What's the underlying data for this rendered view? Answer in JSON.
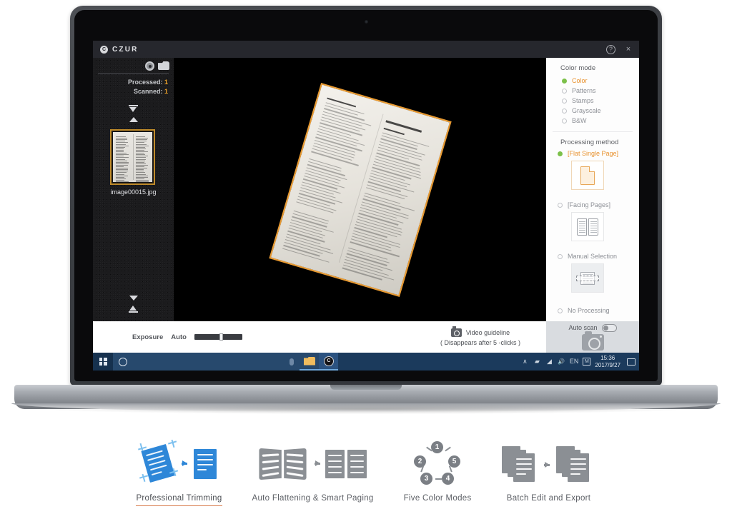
{
  "app": {
    "brand": "CZUR",
    "logo_glyph": "C",
    "help_label": "?",
    "close_label": "×"
  },
  "thumbnail_rail": {
    "settings_icon": "gear-icon",
    "folder_icon": "folder-icon",
    "processed_label": "Processed:",
    "processed_count": "1",
    "scanned_label": "Scanned:",
    "scanned_count": "1",
    "nav_top_icon": "jump-to-top-icon",
    "nav_up_icon": "scroll-up-icon",
    "nav_down_icon": "scroll-down-icon",
    "nav_bottom_icon": "jump-to-bottom-icon",
    "thumbnails": [
      {
        "filename": "image00015.jpg",
        "selected": true
      }
    ]
  },
  "preview": {
    "document_alt": "scanned-page-preview",
    "detection_border_color": "#e89a32"
  },
  "options": {
    "color_mode": {
      "title": "Color mode",
      "selected": "Color",
      "items": [
        {
          "label": "Color",
          "selected": true
        },
        {
          "label": "Patterns",
          "selected": false
        },
        {
          "label": "Stamps",
          "selected": false
        },
        {
          "label": "Grayscale",
          "selected": false
        },
        {
          "label": "B&W",
          "selected": false
        }
      ]
    },
    "processing_method": {
      "title": "Processing method",
      "selected": "[Flat Single Page]",
      "items": [
        {
          "label": "[Flat Single Page]",
          "selected": true,
          "icon": "single-page-icon"
        },
        {
          "label": "[Facing Pages]",
          "selected": false,
          "icon": "open-book-icon"
        },
        {
          "label": "Manual Selection",
          "selected": false,
          "icon": "manual-crop-icon"
        },
        {
          "label": "No Processing",
          "selected": false,
          "icon": "none"
        }
      ]
    },
    "accent_selected": "#e8922f",
    "accent_radio": "#7cc04a"
  },
  "bottom_bar": {
    "exposure_label": "Exposure",
    "auto_label": "Auto",
    "exposure_value": 57,
    "guideline_title": "Video guideline",
    "guideline_note": "( Disappears after 5 -clicks )",
    "guideline_icon": "video-camera-icon",
    "auto_scan_label": "Auto scan",
    "auto_scan_on": false,
    "capture_icon": "camera-capture-icon"
  },
  "taskbar": {
    "start_icon": "windows-start-icon",
    "cortana_icon": "cortana-circle-icon",
    "search_placeholder": "",
    "mic_icon": "microphone-icon",
    "apps": [
      {
        "name": "file-explorer",
        "icon": "folder-icon"
      },
      {
        "name": "czur-scanner",
        "icon": "czur-icon",
        "glyph": "C"
      }
    ],
    "tray": [
      {
        "name": "show-hidden-icons",
        "glyph": "∧"
      },
      {
        "name": "network-icon",
        "glyph": "▰"
      },
      {
        "name": "wifi-icon",
        "glyph": "◢"
      },
      {
        "name": "volume-icon",
        "glyph": "🔊"
      },
      {
        "name": "language-indicator",
        "glyph": "EN"
      },
      {
        "name": "ime-indicator",
        "glyph": "M"
      }
    ],
    "clock_time": "15:36",
    "clock_date": "2017/9/27",
    "action_center_icon": "action-center-icon"
  },
  "features": [
    {
      "label": "Professional Trimming",
      "active": true,
      "icon": "trimming-icon"
    },
    {
      "label": "Auto Flattening & Smart Paging",
      "active": false,
      "icon": "flattening-icon"
    },
    {
      "label": "Five Color Modes",
      "active": false,
      "icon": "color-modes-icon",
      "numbers": [
        "1",
        "2",
        "3",
        "4",
        "5"
      ]
    },
    {
      "label": "Batch Edit and Export",
      "active": false,
      "icon": "batch-export-icon"
    }
  ],
  "feature_underline_color": "#d87a4a"
}
